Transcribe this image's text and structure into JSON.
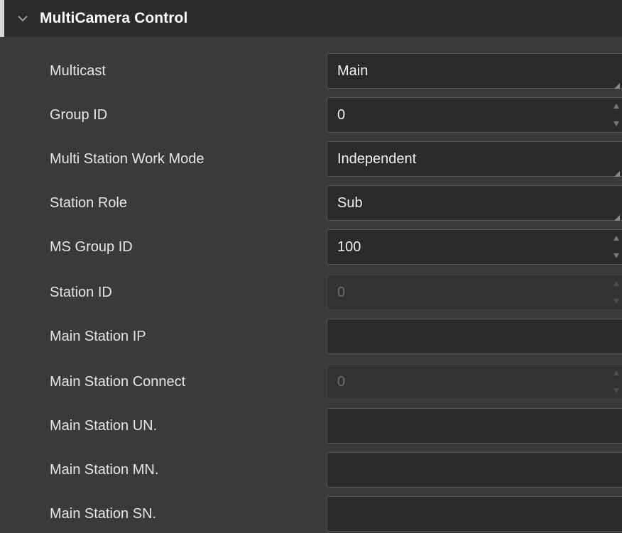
{
  "section": {
    "title": "MultiCamera Control",
    "icon": "chevron-down-icon"
  },
  "rows": [
    {
      "label": "Multicast",
      "value": "Main",
      "type": "dropdown",
      "enabled": true
    },
    {
      "label": "Group ID",
      "value": "0",
      "type": "spin",
      "enabled": true
    },
    {
      "label": "Multi Station Work Mode",
      "value": "Independent",
      "type": "dropdown",
      "enabled": true
    },
    {
      "label": "Station Role",
      "value": "Sub",
      "type": "dropdown",
      "enabled": true
    },
    {
      "label": "MS Group ID",
      "value": "100",
      "type": "spin",
      "enabled": true
    },
    {
      "label": "Station ID",
      "value": "0",
      "type": "spin",
      "enabled": false
    },
    {
      "label": "Main Station IP",
      "value": "",
      "type": "text",
      "enabled": true
    },
    {
      "label": "Main Station Connect",
      "value": "0",
      "type": "spin",
      "enabled": false
    },
    {
      "label": "Main Station UN.",
      "value": "",
      "type": "text",
      "enabled": true
    },
    {
      "label": "Main Station MN.",
      "value": "",
      "type": "text",
      "enabled": true
    },
    {
      "label": "Main Station SN.",
      "value": "",
      "type": "text",
      "enabled": true
    }
  ],
  "colors": {
    "panel_bg": "#3a3a3c",
    "header_bg": "#2b2b2d",
    "field_bg": "#2a2a2c",
    "text": "#e6e6e6",
    "disabled_text": "#6c6c70"
  }
}
